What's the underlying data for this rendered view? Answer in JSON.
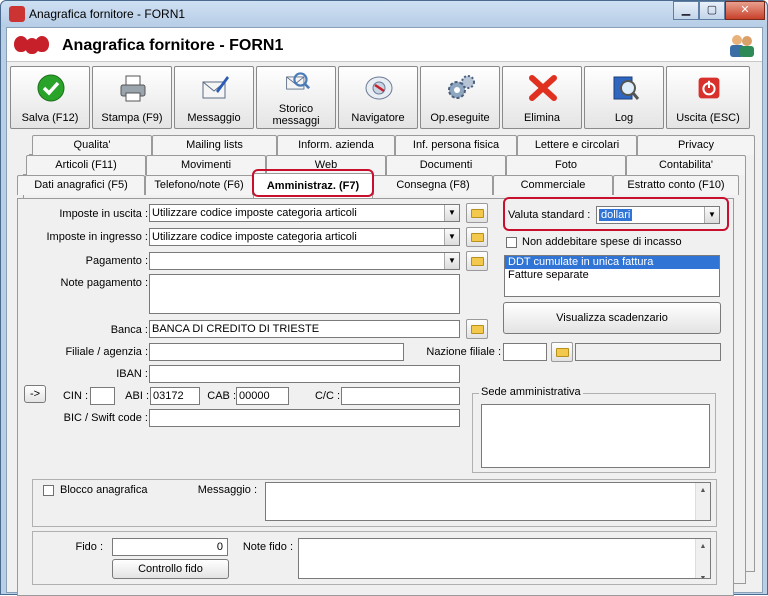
{
  "window": {
    "title": "Anagrafica fornitore - FORN1"
  },
  "header": {
    "title": "Anagrafica fornitore - FORN1"
  },
  "toolbar": {
    "buttons": [
      {
        "label": "Salva (F12)",
        "icon": "check-icon"
      },
      {
        "label": "Stampa (F9)",
        "icon": "printer-icon"
      },
      {
        "label": "Messaggio",
        "icon": "message-icon"
      },
      {
        "label": "Storico\nmessaggi",
        "icon": "history-icon"
      },
      {
        "label": "Navigatore",
        "icon": "navigator-icon"
      },
      {
        "label": "Op.eseguite",
        "icon": "gears-icon"
      },
      {
        "label": "Elimina",
        "icon": "delete-icon"
      },
      {
        "label": "Log",
        "icon": "log-icon"
      },
      {
        "label": "Uscita (ESC)",
        "icon": "exit-icon"
      }
    ]
  },
  "tabs": {
    "row1": [
      "Qualita'",
      "Mailing lists",
      "Inform. azienda",
      "Inf. persona fisica",
      "Lettere e circolari",
      "Privacy"
    ],
    "row2": [
      "Articoli (F11)",
      "Movimenti",
      "Web",
      "Documenti",
      "Foto",
      "Contabilita'"
    ],
    "row3": [
      "Dati anagrafici (F5)",
      "Telefono/note (F6)",
      "Amministraz. (F7)",
      "Consegna (F8)",
      "Commerciale",
      "Estratto conto (F10)"
    ]
  },
  "form": {
    "imposte_uscita_label": "Imposte in uscita :",
    "imposte_uscita_value": "Utilizzare codice imposte categoria articoli",
    "imposte_ingresso_label": "Imposte in ingresso :",
    "imposte_ingresso_value": "Utilizzare codice imposte categoria articoli",
    "pagamento_label": "Pagamento :",
    "pagamento_value": "",
    "note_pagamento_label": "Note pagamento :",
    "banca_label": "Banca :",
    "banca_value": "BANCA DI CREDITO DI TRIESTE",
    "filiale_label": "Filiale / agenzia :",
    "nazione_filiale_label": "Nazione filiale :",
    "iban_label": "IBAN :",
    "arrow_button": "->",
    "cin_label": "CIN :",
    "abi_label": "ABI :",
    "abi_value": "03172",
    "cab_label": "CAB :",
    "cab_value": "00000",
    "cc_label": "C/C :",
    "bic_label": "BIC / Swift code :",
    "valuta_label": "Valuta standard :",
    "valuta_value": "dollari",
    "non_addebitare_label": "Non addebitare spese di incasso",
    "list_items": [
      "DDT cumulate in unica fattura",
      "Fatture separate"
    ],
    "visualizza_button": "Visualizza scadenzario",
    "sede_label": "Sede amministrativa",
    "blocco_label": "Blocco anagrafica",
    "messaggio_label": "Messaggio :",
    "fido_label": "Fido :",
    "fido_value": "0",
    "note_fido_label": "Note fido :",
    "controllo_fido_button": "Controllo fido"
  }
}
